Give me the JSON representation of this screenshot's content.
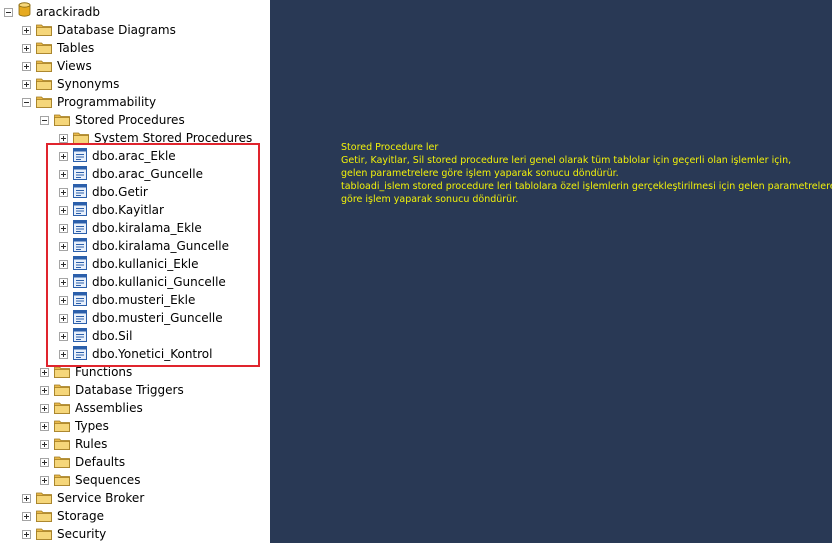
{
  "colors": {
    "note_background": "#293955",
    "note_text": "#f2f20a",
    "highlight_border": "#e0242d",
    "tree_background": "#ffffff"
  },
  "tree": {
    "database": {
      "label": "arackiradb",
      "icon": "database-icon",
      "toggle": "minus"
    },
    "top_folders": [
      {
        "label": "Database Diagrams",
        "icon": "folder-icon",
        "toggle": "plus"
      },
      {
        "label": "Tables",
        "icon": "folder-icon",
        "toggle": "plus"
      },
      {
        "label": "Views",
        "icon": "folder-icon",
        "toggle": "plus"
      },
      {
        "label": "Synonyms",
        "icon": "folder-icon",
        "toggle": "plus"
      },
      {
        "label": "Programmability",
        "icon": "folder-icon",
        "toggle": "minus"
      }
    ],
    "programmability": {
      "stored_procedures": {
        "label": "Stored Procedures",
        "icon": "folder-icon",
        "toggle": "minus"
      },
      "system_stored_procedures": {
        "label": "System Stored Procedures",
        "icon": "folder-icon",
        "toggle": "plus"
      },
      "procedures": [
        {
          "label": "dbo.arac_Ekle",
          "icon": "stored-procedure-icon",
          "toggle": "plus"
        },
        {
          "label": "dbo.arac_Guncelle",
          "icon": "stored-procedure-icon",
          "toggle": "plus"
        },
        {
          "label": "dbo.Getir",
          "icon": "stored-procedure-icon",
          "toggle": "plus"
        },
        {
          "label": "dbo.Kayitlar",
          "icon": "stored-procedure-icon",
          "toggle": "plus"
        },
        {
          "label": "dbo.kiralama_Ekle",
          "icon": "stored-procedure-icon",
          "toggle": "plus"
        },
        {
          "label": "dbo.kiralama_Guncelle",
          "icon": "stored-procedure-icon",
          "toggle": "plus"
        },
        {
          "label": "dbo.kullanici_Ekle",
          "icon": "stored-procedure-icon",
          "toggle": "plus"
        },
        {
          "label": "dbo.kullanici_Guncelle",
          "icon": "stored-procedure-icon",
          "toggle": "plus"
        },
        {
          "label": "dbo.musteri_Ekle",
          "icon": "stored-procedure-icon",
          "toggle": "plus"
        },
        {
          "label": "dbo.musteri_Guncelle",
          "icon": "stored-procedure-icon",
          "toggle": "plus"
        },
        {
          "label": "dbo.Sil",
          "icon": "stored-procedure-icon",
          "toggle": "plus"
        },
        {
          "label": "dbo.Yonetici_Kontrol",
          "icon": "stored-procedure-icon",
          "toggle": "plus"
        }
      ],
      "other_folders": [
        {
          "label": "Functions",
          "icon": "folder-icon",
          "toggle": "plus"
        },
        {
          "label": "Database Triggers",
          "icon": "folder-icon",
          "toggle": "plus"
        },
        {
          "label": "Assemblies",
          "icon": "folder-icon",
          "toggle": "plus"
        },
        {
          "label": "Types",
          "icon": "folder-icon",
          "toggle": "plus"
        },
        {
          "label": "Rules",
          "icon": "folder-icon",
          "toggle": "plus"
        },
        {
          "label": "Defaults",
          "icon": "folder-icon",
          "toggle": "plus"
        },
        {
          "label": "Sequences",
          "icon": "folder-icon",
          "toggle": "plus"
        }
      ]
    },
    "bottom_folders": [
      {
        "label": "Service Broker",
        "icon": "folder-icon",
        "toggle": "plus"
      },
      {
        "label": "Storage",
        "icon": "folder-icon",
        "toggle": "plus"
      },
      {
        "label": "Security",
        "icon": "folder-icon",
        "toggle": "plus"
      }
    ]
  },
  "note": {
    "lines": [
      "Stored Procedure ler",
      "Getir, Kayitlar, Sil stored procedure leri genel olarak tüm tablolar için geçerli olan işlemler için,",
      "gelen parametrelere göre işlem yaparak sonucu döndürür.",
      "tabloadi_islem stored procedure leri tablolara özel işlemlerin gerçekleştirilmesi için gelen parametrelere",
      "göre işlem yaparak sonucu döndürür."
    ]
  }
}
